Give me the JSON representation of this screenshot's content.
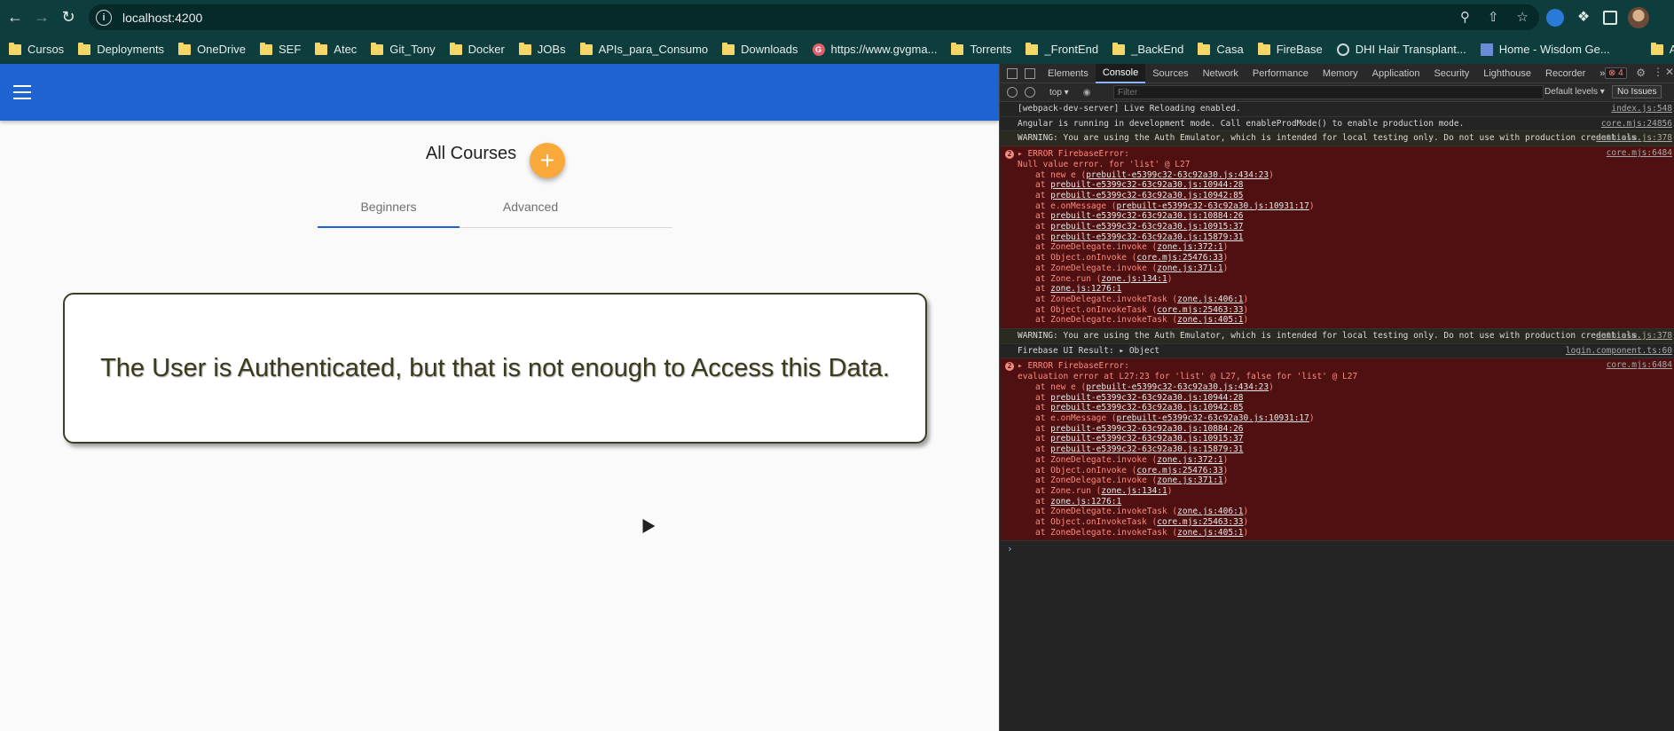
{
  "browser": {
    "url": "localhost:4200",
    "bookmarks": [
      "Cursos",
      "Deployments",
      "OneDrive",
      "SEF",
      "Atec",
      "Git_Tony",
      "Docker",
      "JOBs",
      "APIs_para_Consumo",
      "Downloads",
      "https://www.gvgma...",
      "Torrents",
      "_FrontEnd",
      "_BackEnd",
      "Casa",
      "FireBase",
      "DHI Hair Transplant...",
      "Home - Wisdom Ge..."
    ],
    "all_bookmarks": "All Bookmarks"
  },
  "page": {
    "title": "All Courses",
    "fab_label": "+",
    "tabs": [
      "Beginners",
      "Advanced"
    ],
    "message": "The User is Authenticated, but that is not enough to Access this Data."
  },
  "devtools": {
    "tabs": [
      "Elements",
      "Console",
      "Sources",
      "Network",
      "Performance",
      "Memory",
      "Application",
      "Security",
      "Lighthouse",
      "Recorder",
      "»"
    ],
    "error_count": "⊗ 4",
    "context": "top ▾",
    "filter_placeholder": "Filter",
    "levels": "Default levels ▾",
    "issues": "No Issues",
    "messages": [
      {
        "type": "log",
        "text": "[webpack-dev-server] Live Reloading enabled.",
        "source": "index.js:548"
      },
      {
        "type": "log",
        "text": "Angular is running in development mode. Call enableProdMode() to enable production mode.",
        "source": "core.mjs:24856"
      },
      {
        "type": "warn",
        "text": "WARNING: You are using the Auth Emulator, which is intended for local testing only.  Do not use with production credentials.",
        "source": "auth.esm.js:378"
      },
      {
        "type": "error",
        "badge": "2",
        "head": "▸ ERROR FirebaseError:",
        "sub": "Null value error. for 'list' @ L27",
        "source": "core.mjs:6484",
        "stack": [
          [
            "at new e (",
            "prebuilt-e5399c32-63c92a30.js:434:23",
            ")"
          ],
          [
            "at ",
            "prebuilt-e5399c32-63c92a30.js:10944:28",
            ""
          ],
          [
            "at ",
            "prebuilt-e5399c32-63c92a30.js:10942:85",
            ""
          ],
          [
            "at e.onMessage (",
            "prebuilt-e5399c32-63c92a30.js:10931:17",
            ")"
          ],
          [
            "at ",
            "prebuilt-e5399c32-63c92a30.js:10884:26",
            ""
          ],
          [
            "at ",
            "prebuilt-e5399c32-63c92a30.js:10915:37",
            ""
          ],
          [
            "at ",
            "prebuilt-e5399c32-63c92a30.js:15879:31",
            ""
          ],
          [
            "at ZoneDelegate.invoke (",
            "zone.js:372:1",
            ")"
          ],
          [
            "at Object.onInvoke (",
            "core.mjs:25476:33",
            ")"
          ],
          [
            "at ZoneDelegate.invoke (",
            "zone.js:371:1",
            ")"
          ],
          [
            "at Zone.run (",
            "zone.js:134:1",
            ")"
          ],
          [
            "at ",
            "zone.js:1276:1",
            ""
          ],
          [
            "at ZoneDelegate.invokeTask (",
            "zone.js:406:1",
            ")"
          ],
          [
            "at Object.onInvokeTask (",
            "core.mjs:25463:33",
            ")"
          ],
          [
            "at ZoneDelegate.invokeTask (",
            "zone.js:405:1",
            ")"
          ]
        ]
      },
      {
        "type": "warn",
        "text": "WARNING: You are using the Auth Emulator, which is intended for local testing only.  Do not use with production credentials.",
        "source": "auth.esm.js:378"
      },
      {
        "type": "log",
        "text": "Firebase UI Result:   ▸ Object",
        "source": "login.component.ts:60"
      },
      {
        "type": "error",
        "badge": "2",
        "head": "▸ ERROR FirebaseError:",
        "sub": "evaluation error at L27:23 for 'list' @ L27, false for 'list' @ L27",
        "source": "core.mjs:6484",
        "stack": [
          [
            "at new e (",
            "prebuilt-e5399c32-63c92a30.js:434:23",
            ")"
          ],
          [
            "at ",
            "prebuilt-e5399c32-63c92a30.js:10944:28",
            ""
          ],
          [
            "at ",
            "prebuilt-e5399c32-63c92a30.js:10942:85",
            ""
          ],
          [
            "at e.onMessage (",
            "prebuilt-e5399c32-63c92a30.js:10931:17",
            ")"
          ],
          [
            "at ",
            "prebuilt-e5399c32-63c92a30.js:10884:26",
            ""
          ],
          [
            "at ",
            "prebuilt-e5399c32-63c92a30.js:10915:37",
            ""
          ],
          [
            "at ",
            "prebuilt-e5399c32-63c92a30.js:15879:31",
            ""
          ],
          [
            "at ZoneDelegate.invoke (",
            "zone.js:372:1",
            ")"
          ],
          [
            "at Object.onInvoke (",
            "core.mjs:25476:33",
            ")"
          ],
          [
            "at ZoneDelegate.invoke (",
            "zone.js:371:1",
            ")"
          ],
          [
            "at Zone.run (",
            "zone.js:134:1",
            ")"
          ],
          [
            "at ",
            "zone.js:1276:1",
            ""
          ],
          [
            "at ZoneDelegate.invokeTask (",
            "zone.js:406:1",
            ")"
          ],
          [
            "at Object.onInvokeTask (",
            "core.mjs:25463:33",
            ")"
          ],
          [
            "at ZoneDelegate.invokeTask (",
            "zone.js:405:1",
            ")"
          ]
        ]
      }
    ],
    "prompt": "›"
  },
  "colors": {
    "chrome": "#0d3d3d",
    "appbar": "#1e63d1",
    "fab": "#f9a83a",
    "error_bg": "#4e1010"
  }
}
